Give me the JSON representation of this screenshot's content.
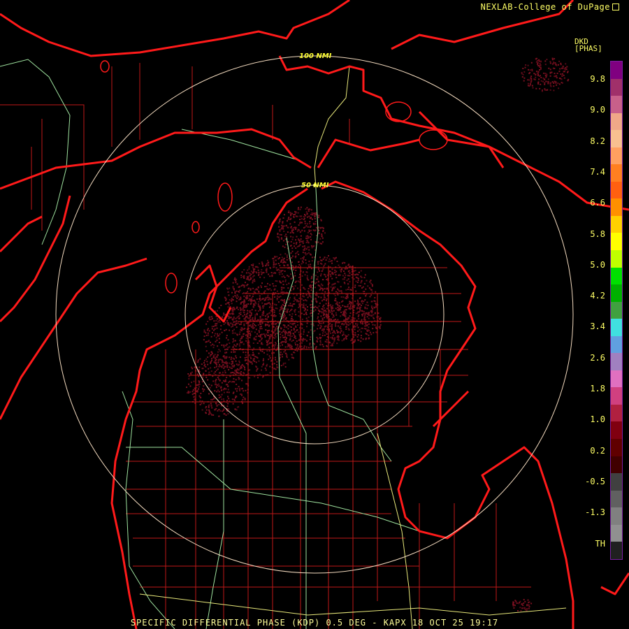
{
  "credit": "NEXLAB-College of DuPage",
  "product_code": "DKD",
  "units": "[PHAS]",
  "footer": "SPECIFIC DIFFERENTIAL PHASE (KDP) 0.5 DEG - KAPX 18 OCT 25 19:17",
  "rings": [
    {
      "label": "100 NMI"
    },
    {
      "label": "50 NMI"
    }
  ],
  "scale_labels": [
    "9.8",
    "9.0",
    "8.2",
    "7.4",
    "6.6",
    "5.8",
    "5.0",
    "4.2",
    "3.4",
    "2.6",
    "1.8",
    "1.0",
    "0.2",
    "-0.5",
    "-1.3",
    "TH"
  ],
  "scale_colors": [
    "#800080",
    "#a0306a",
    "#c8608a",
    "#f0a888",
    "#f8c090",
    "#ffa060",
    "#ff7f20",
    "#ff6010",
    "#ff9000",
    "#ffd000",
    "#ffff00",
    "#c0ff00",
    "#00e000",
    "#00b000",
    "#40a040",
    "#40e0e0",
    "#60a0e0",
    "#a080c0",
    "#e070c0",
    "#d04080",
    "#b02040",
    "#800010",
    "#600000",
    "#400000",
    "#404040",
    "#606060",
    "#808080",
    "#909090",
    "#202020"
  ],
  "colors": {
    "coast": "#ff1a1a",
    "county": "#c01818",
    "highway": "#9fe39f",
    "road": "#e8e87a",
    "ring": "#f5dcc0",
    "echo": "#7a1020"
  }
}
